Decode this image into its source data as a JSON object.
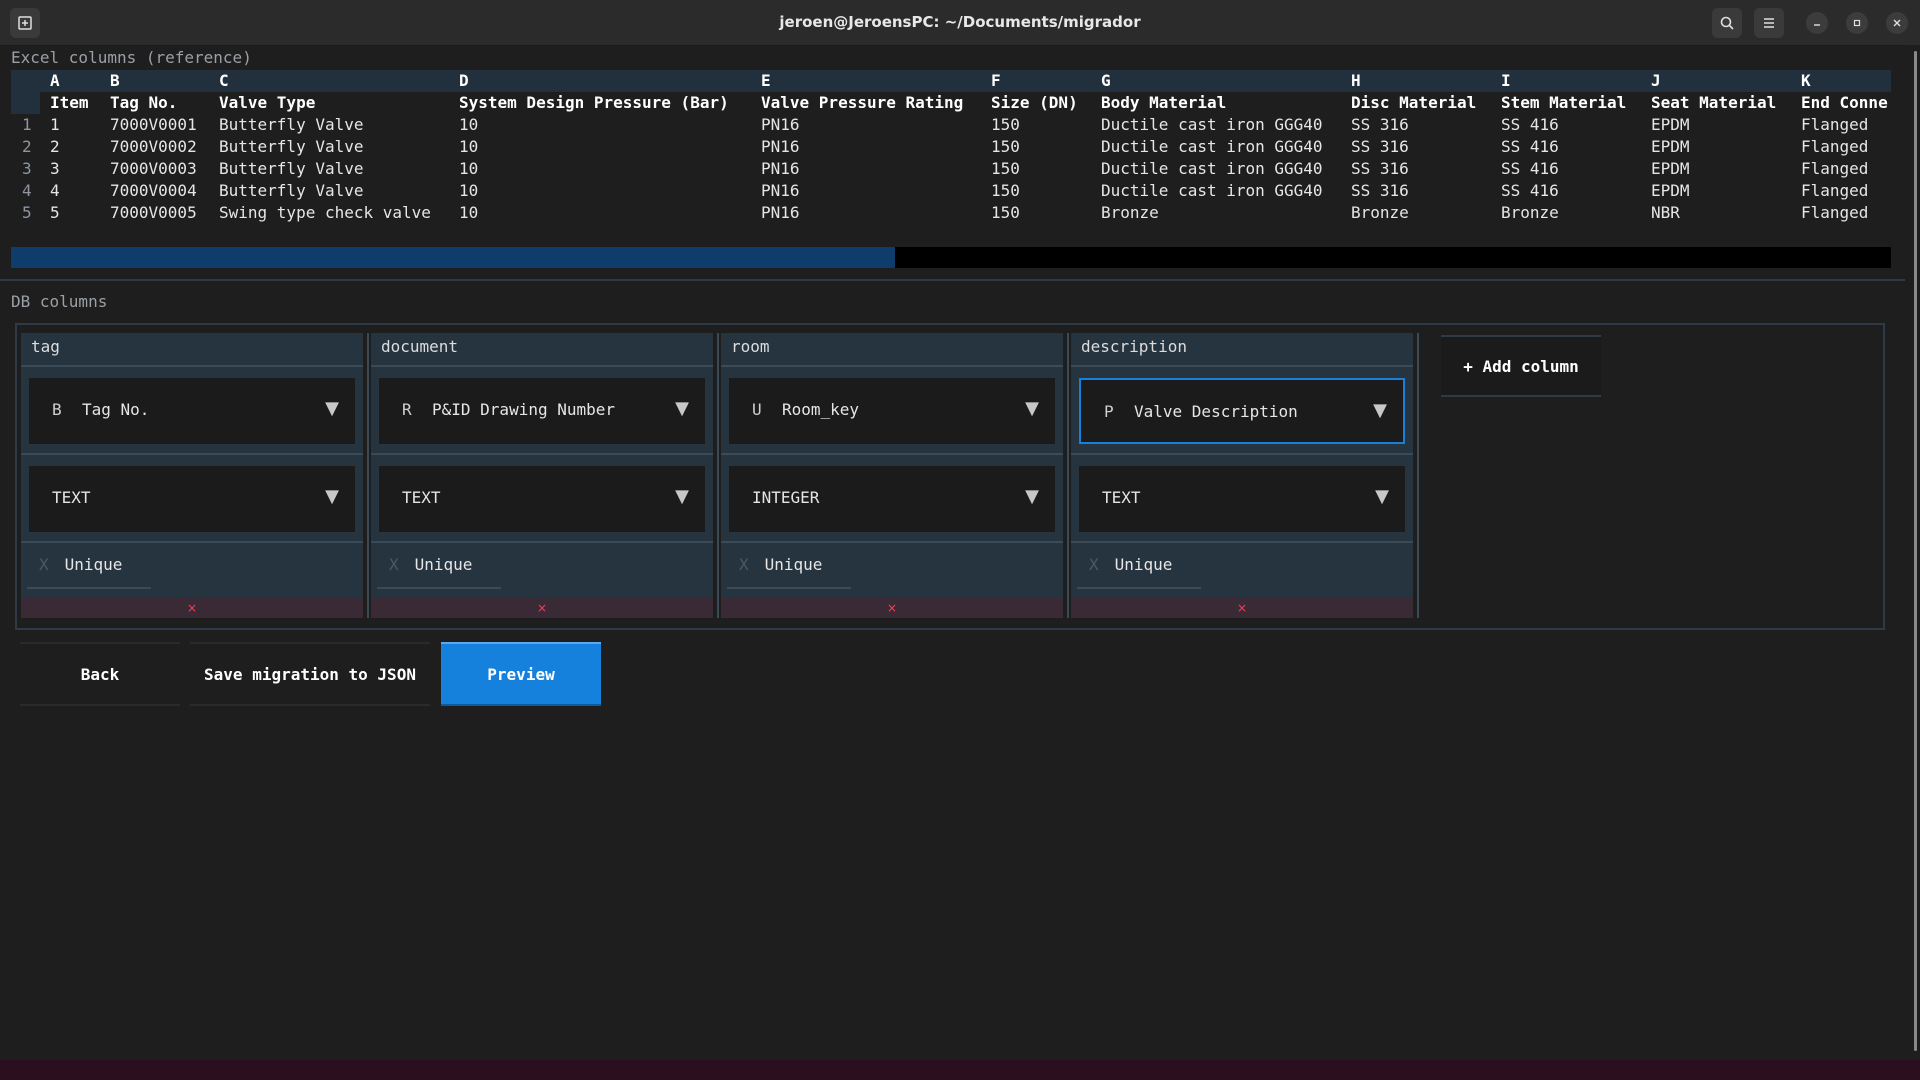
{
  "window": {
    "title": "jeroen@JeroensPC: ~/Documents/migrador",
    "new_tab_icon": "new-tab-icon",
    "search_icon": "search-icon",
    "menu_icon": "hamburger-menu-icon"
  },
  "excel": {
    "section_label": "Excel columns  (reference)",
    "column_letters": [
      "A",
      "B",
      "C",
      "D",
      "E",
      "F",
      "G",
      "H",
      "I",
      "J",
      "K"
    ],
    "headers": [
      "Item",
      "Tag No.",
      "Valve Type",
      "System Design Pressure (Bar)",
      "Valve Pressure Rating",
      "Size (DN)",
      "Body Material",
      "Disc Material",
      "Stem Material",
      "Seat Material",
      "End Conne"
    ],
    "rows": [
      {
        "n": "1",
        "cells": [
          "1",
          "7000V0001",
          "Butterfly Valve",
          "10",
          "PN16",
          "150",
          "Ductile cast iron GGG40",
          "SS 316",
          "SS 416",
          "EPDM",
          "Flanged"
        ]
      },
      {
        "n": "2",
        "cells": [
          "2",
          "7000V0002",
          "Butterfly Valve",
          "10",
          "PN16",
          "150",
          "Ductile cast iron GGG40",
          "SS 316",
          "SS 416",
          "EPDM",
          "Flanged"
        ]
      },
      {
        "n": "3",
        "cells": [
          "3",
          "7000V0003",
          "Butterfly Valve",
          "10",
          "PN16",
          "150",
          "Ductile cast iron GGG40",
          "SS 316",
          "SS 416",
          "EPDM",
          "Flanged"
        ]
      },
      {
        "n": "4",
        "cells": [
          "4",
          "7000V0004",
          "Butterfly Valve",
          "10",
          "PN16",
          "150",
          "Ductile cast iron GGG40",
          "SS 316",
          "SS 416",
          "EPDM",
          "Flanged"
        ]
      },
      {
        "n": "5",
        "cells": [
          "5",
          "7000V0005",
          "Swing type check valve",
          "10",
          "PN16",
          "150",
          "Bronze",
          "Bronze",
          "Bronze",
          "NBR",
          "Flanged"
        ]
      }
    ],
    "horizontal_scroll_fraction": 0.47
  },
  "db": {
    "section_label": "DB columns",
    "columns": [
      {
        "name": "tag",
        "source_key": "B",
        "source_label": "Tag No.",
        "type": "TEXT",
        "unique_mark": "X",
        "unique_label": "Unique",
        "delete_label": "×",
        "focused": false
      },
      {
        "name": "document",
        "source_key": "R",
        "source_label": "P&ID Drawing Number",
        "type": "TEXT",
        "unique_mark": "X",
        "unique_label": "Unique",
        "delete_label": "×",
        "focused": false
      },
      {
        "name": "room",
        "source_key": "U",
        "source_label": "Room_key",
        "type": "INTEGER",
        "unique_mark": "X",
        "unique_label": "Unique",
        "delete_label": "×",
        "focused": false
      },
      {
        "name": "description",
        "source_key": "P",
        "source_label": "Valve Description",
        "type": "TEXT",
        "unique_mark": "X",
        "unique_label": "Unique",
        "delete_label": "×",
        "focused": true
      }
    ],
    "add_column_label": "+ Add column",
    "dropdown_arrow": "▼"
  },
  "actions": {
    "back": "Back",
    "save": "Save migration to JSON",
    "preview": "Preview"
  },
  "colors": {
    "accent": "#1681dc",
    "focus_border": "#1a7fd8",
    "delete_x": "#ff3c5a"
  }
}
